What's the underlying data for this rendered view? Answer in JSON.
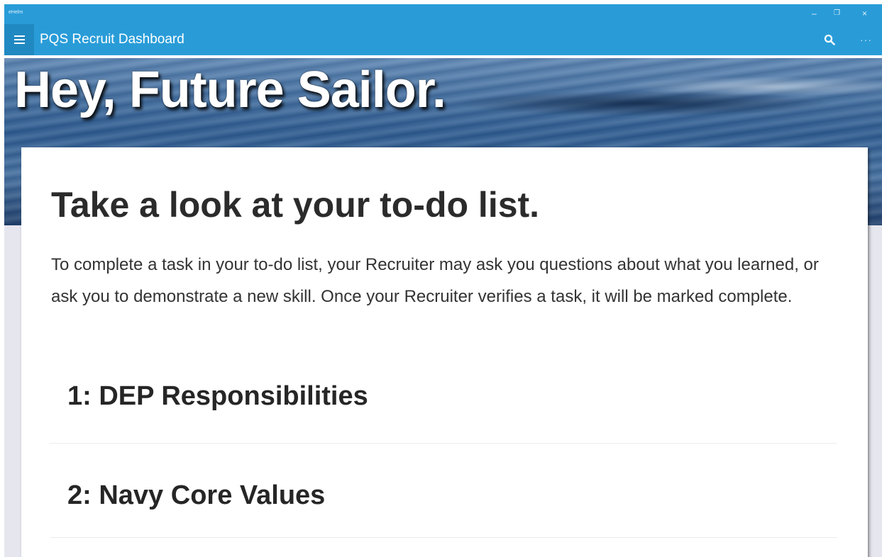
{
  "system": {
    "app_id": "eHelm"
  },
  "appbar": {
    "title": "PQS Recruit Dashboard",
    "more_label": "···"
  },
  "hero": {
    "headline": "Hey, Future Sailor."
  },
  "card": {
    "title": "Take a look at your to-do list.",
    "description": "To complete a task in your to-do list, your Recruiter may ask you questions about what you learned, or ask you to demonstrate a new skill. Once your Recruiter verifies a task, it will be marked complete.",
    "tasks": [
      {
        "label": "1: DEP Responsibilities"
      },
      {
        "label": "2: Navy Core Values"
      }
    ]
  },
  "colors": {
    "accent": "#299cd8",
    "hamburger_bg": "#2089c2",
    "page_bg": "#e6e6ef",
    "card_bg": "#ffffff",
    "text_dark": "#2b2b2b"
  },
  "icons": {
    "menu": "hamburger-menu-icon",
    "search": "search-icon",
    "more": "more-options-icon",
    "minimize": "minimize-icon",
    "maximize": "restore-icon",
    "close": "close-icon"
  }
}
